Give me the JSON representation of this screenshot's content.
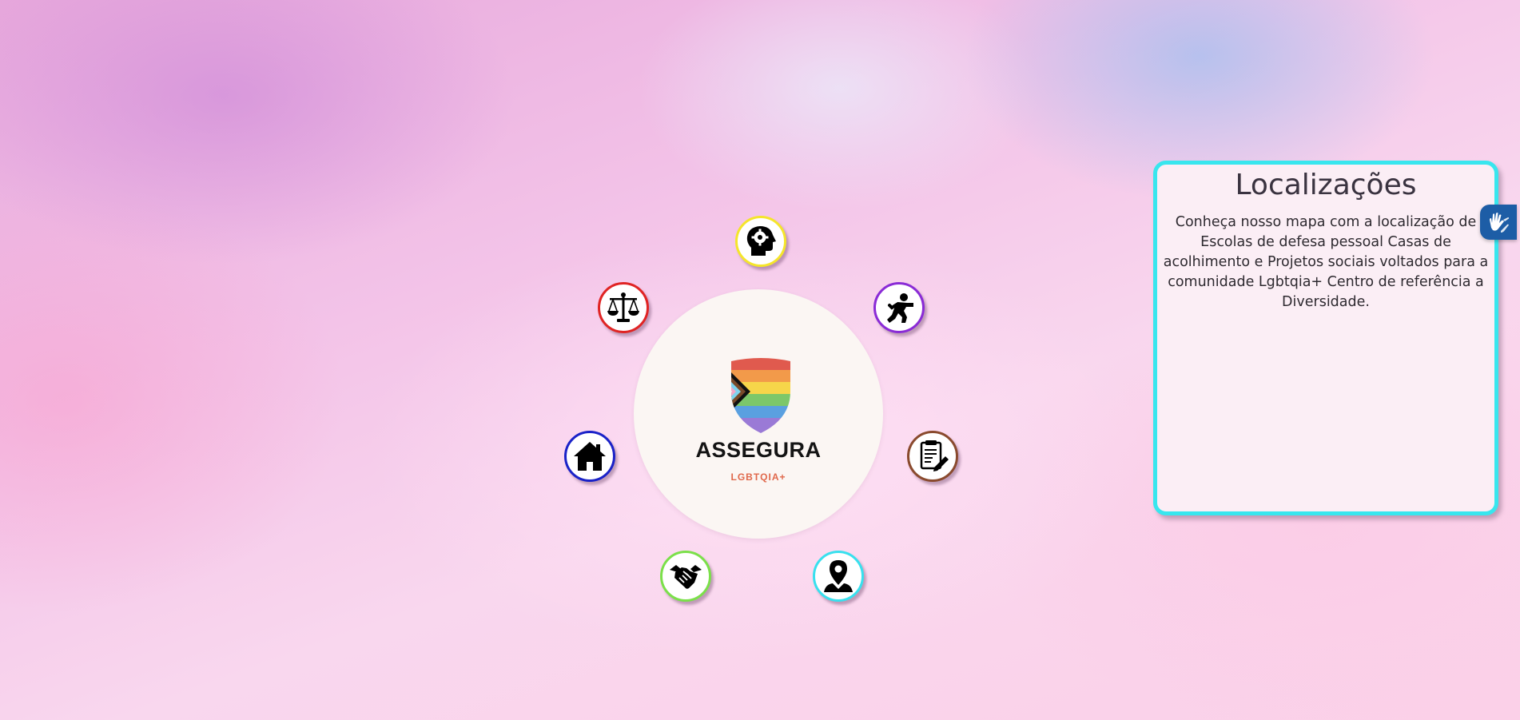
{
  "brand": {
    "name": "ASSEGURA",
    "tagline": "LGBTQIA+"
  },
  "colors": {
    "panel_border": "#38e6ee",
    "accessibility_button": "#1d5da6",
    "tagline": "#e0684b"
  },
  "orbit_buttons": [
    {
      "icon": "mental-health-head-icon",
      "ring_color": "#f5e52b"
    },
    {
      "icon": "self-defense-fighter-icon",
      "ring_color": "#8a2bd6"
    },
    {
      "icon": "document-edit-icon",
      "ring_color": "#8a4a2e"
    },
    {
      "icon": "map-location-pin-icon",
      "ring_color": "#38e0ee"
    },
    {
      "icon": "handshake-icon",
      "ring_color": "#7be04a"
    },
    {
      "icon": "house-icon",
      "ring_color": "#1a22c8"
    },
    {
      "icon": "justice-scales-icon",
      "ring_color": "#e02424"
    }
  ],
  "info_panel": {
    "title": "Localizações",
    "description": "Conheça nosso mapa com a localização de Escolas de defesa pessoal Casas de acolhimento e Projetos sociais voltados para a comunidade Lgbtqia+ Centro de referência a Diversidade."
  },
  "accessibility": {
    "icon": "sign-language-hands-icon"
  }
}
